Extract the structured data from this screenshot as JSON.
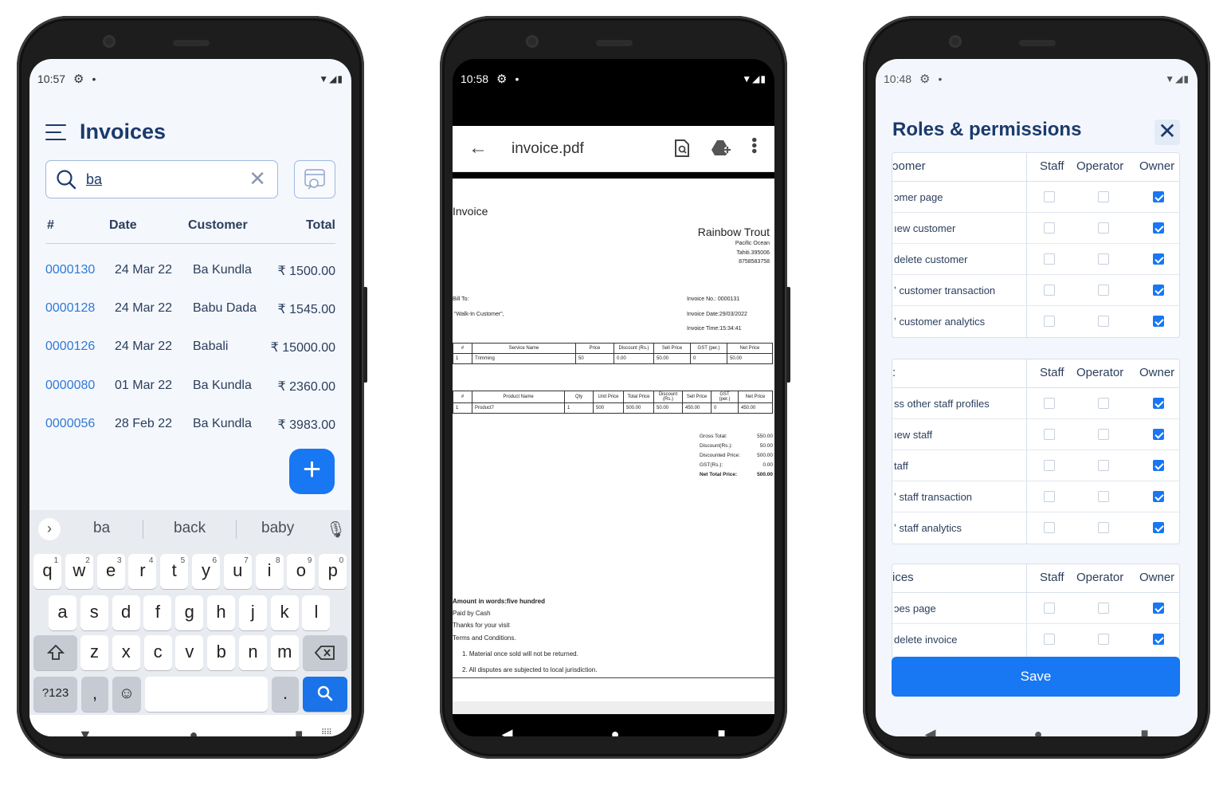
{
  "invoices_screen": {
    "status": {
      "time": "10:57"
    },
    "title": "Invoices",
    "search": {
      "value": "ba"
    },
    "columns": [
      "#",
      "Date",
      "Customer",
      "Total"
    ],
    "rows": [
      {
        "no": "0000130",
        "date": "24 Mar 22",
        "customer": "Ba Kundla",
        "total": "₹ 1500.00"
      },
      {
        "no": "0000128",
        "date": "24 Mar 22",
        "customer": "Babu Dada",
        "total": "₹ 1545.00"
      },
      {
        "no": "0000126",
        "date": "24 Mar 22",
        "customer": "Babali",
        "total": "₹ 15000.00"
      },
      {
        "no": "0000080",
        "date": "01 Mar 22",
        "customer": "Ba Kundla",
        "total": "₹ 2360.00"
      },
      {
        "no": "0000056",
        "date": "28 Feb 22",
        "customer": "Ba Kundla",
        "total": "₹ 3983.00"
      }
    ],
    "keyboard": {
      "suggestions": [
        "ba",
        "back",
        "baby"
      ],
      "row1": [
        "q",
        "w",
        "e",
        "r",
        "t",
        "y",
        "u",
        "i",
        "o",
        "p"
      ],
      "row1_nums": [
        "1",
        "2",
        "3",
        "4",
        "5",
        "6",
        "7",
        "8",
        "9",
        "0"
      ],
      "row2": [
        "a",
        "s",
        "d",
        "f",
        "g",
        "h",
        "j",
        "k",
        "l"
      ],
      "row3": [
        "z",
        "x",
        "c",
        "v",
        "b",
        "n",
        "m"
      ],
      "symbols": "?123",
      "comma": ",",
      "period": "."
    }
  },
  "pdf_screen": {
    "status": {
      "time": "10:58"
    },
    "file_name": "invoice.pdf",
    "doc": {
      "heading": "Invoice",
      "company": "Rainbow Trout",
      "address1": "Pacific Ocean",
      "address2": "Tahiti.395006",
      "phone": "8758583758",
      "bill_to": "Bill To:",
      "customer": "\"Walk-In Customer\",",
      "invoice_no": "Invoice No.: 0000131",
      "invoice_date": "Invoice Date:29/03/2022",
      "invoice_time": "Invoice Time:15:34:41",
      "service_headers": [
        "#",
        "Service Name",
        "Price",
        "Discount (Rs.)",
        "Sell Price",
        "GST (per.)",
        "Net Price"
      ],
      "service_row": [
        "1",
        "Trimming",
        "50",
        "0.00",
        "50.00",
        "0",
        "50.00"
      ],
      "product_headers": [
        "#",
        "Product Name",
        "Qty",
        "Unit Price",
        "Total Price",
        "Discount (Rs.)",
        "Sell Price",
        "GST (per.)",
        "Net Price"
      ],
      "product_row": [
        "1",
        "Product7",
        "1",
        "500",
        "500.00",
        "50.00",
        "450.00",
        "0",
        "450.00"
      ],
      "totals": [
        {
          "label": "Gross Total:",
          "value": "550.00"
        },
        {
          "label": "Discount(Rs.):",
          "value": "50.00"
        },
        {
          "label": "Discounted Price:",
          "value": "500.00"
        },
        {
          "label": "GST(Rs.):",
          "value": "0.00"
        },
        {
          "label": "Net Total Price:",
          "value": "500.00"
        }
      ],
      "amount_words": "Amount in words:five hundred",
      "paid_by": "Paid by Cash",
      "thanks": "Thanks for your visit",
      "terms": "Terms and Conditions.",
      "term1": "1. Material once sold will not be returned.",
      "term2": "2. All disputes are subjected to local jurisdiction."
    }
  },
  "roles_screen": {
    "status": {
      "time": "10:48"
    },
    "title": "Roles & permissions",
    "role_headers": [
      "Staff",
      "Operator",
      "Owner"
    ],
    "groups": [
      {
        "name": "ɔomer",
        "items": [
          "ɔmer page",
          "ıew customer",
          "delete customer",
          "ʼ customer transaction",
          "ʼ customer analytics"
        ]
      },
      {
        "name": ":",
        "items": [
          "ss other staff profiles",
          "ıew staff",
          "taff",
          "ʼ staff transaction",
          "ʼ staff analytics"
        ]
      },
      {
        "name": "ices",
        "items": [
          "ɔes page",
          "delete invoice"
        ]
      }
    ],
    "save_label": "Save"
  }
}
